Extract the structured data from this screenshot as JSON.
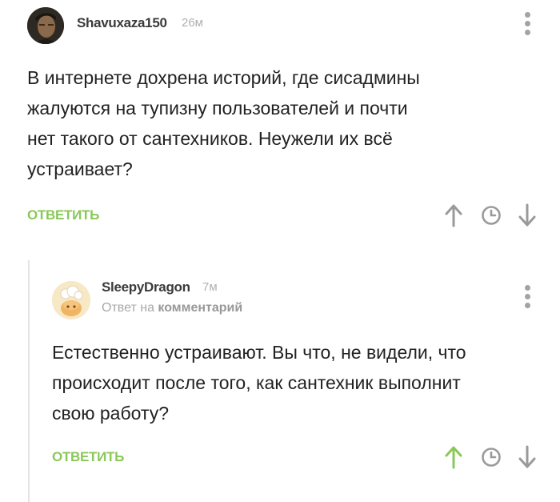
{
  "comments": [
    {
      "username": "Shavuxaza150",
      "time": "26м",
      "text_lines": [
        "В интернете дохрена историй, где сисадмины",
        "жалуются на тупизну пользователей и почти",
        "нет такого от сантехников. Неужели их всё",
        "устраивает?"
      ],
      "reply_label": "ОТВЕТИТЬ"
    },
    {
      "username": "SleepyDragon",
      "time": "7м",
      "reply_to_prefix": "Ответ на",
      "reply_to_target": "комментарий",
      "text_lines": [
        "Естественно устраивают. Вы что, не видели, что",
        "происходит после того, как сантехник выполнит",
        "свою работу?"
      ],
      "reply_label": "ОТВЕТИТЬ",
      "upvoted": true
    }
  ],
  "icons": {
    "menu": "more-vertical-icon",
    "upvote": "arrow-up-icon",
    "save": "clock-icon",
    "downvote": "arrow-down-icon"
  },
  "colors": {
    "accent_green": "#8ac858",
    "icon_grey": "#9a9a9a"
  }
}
